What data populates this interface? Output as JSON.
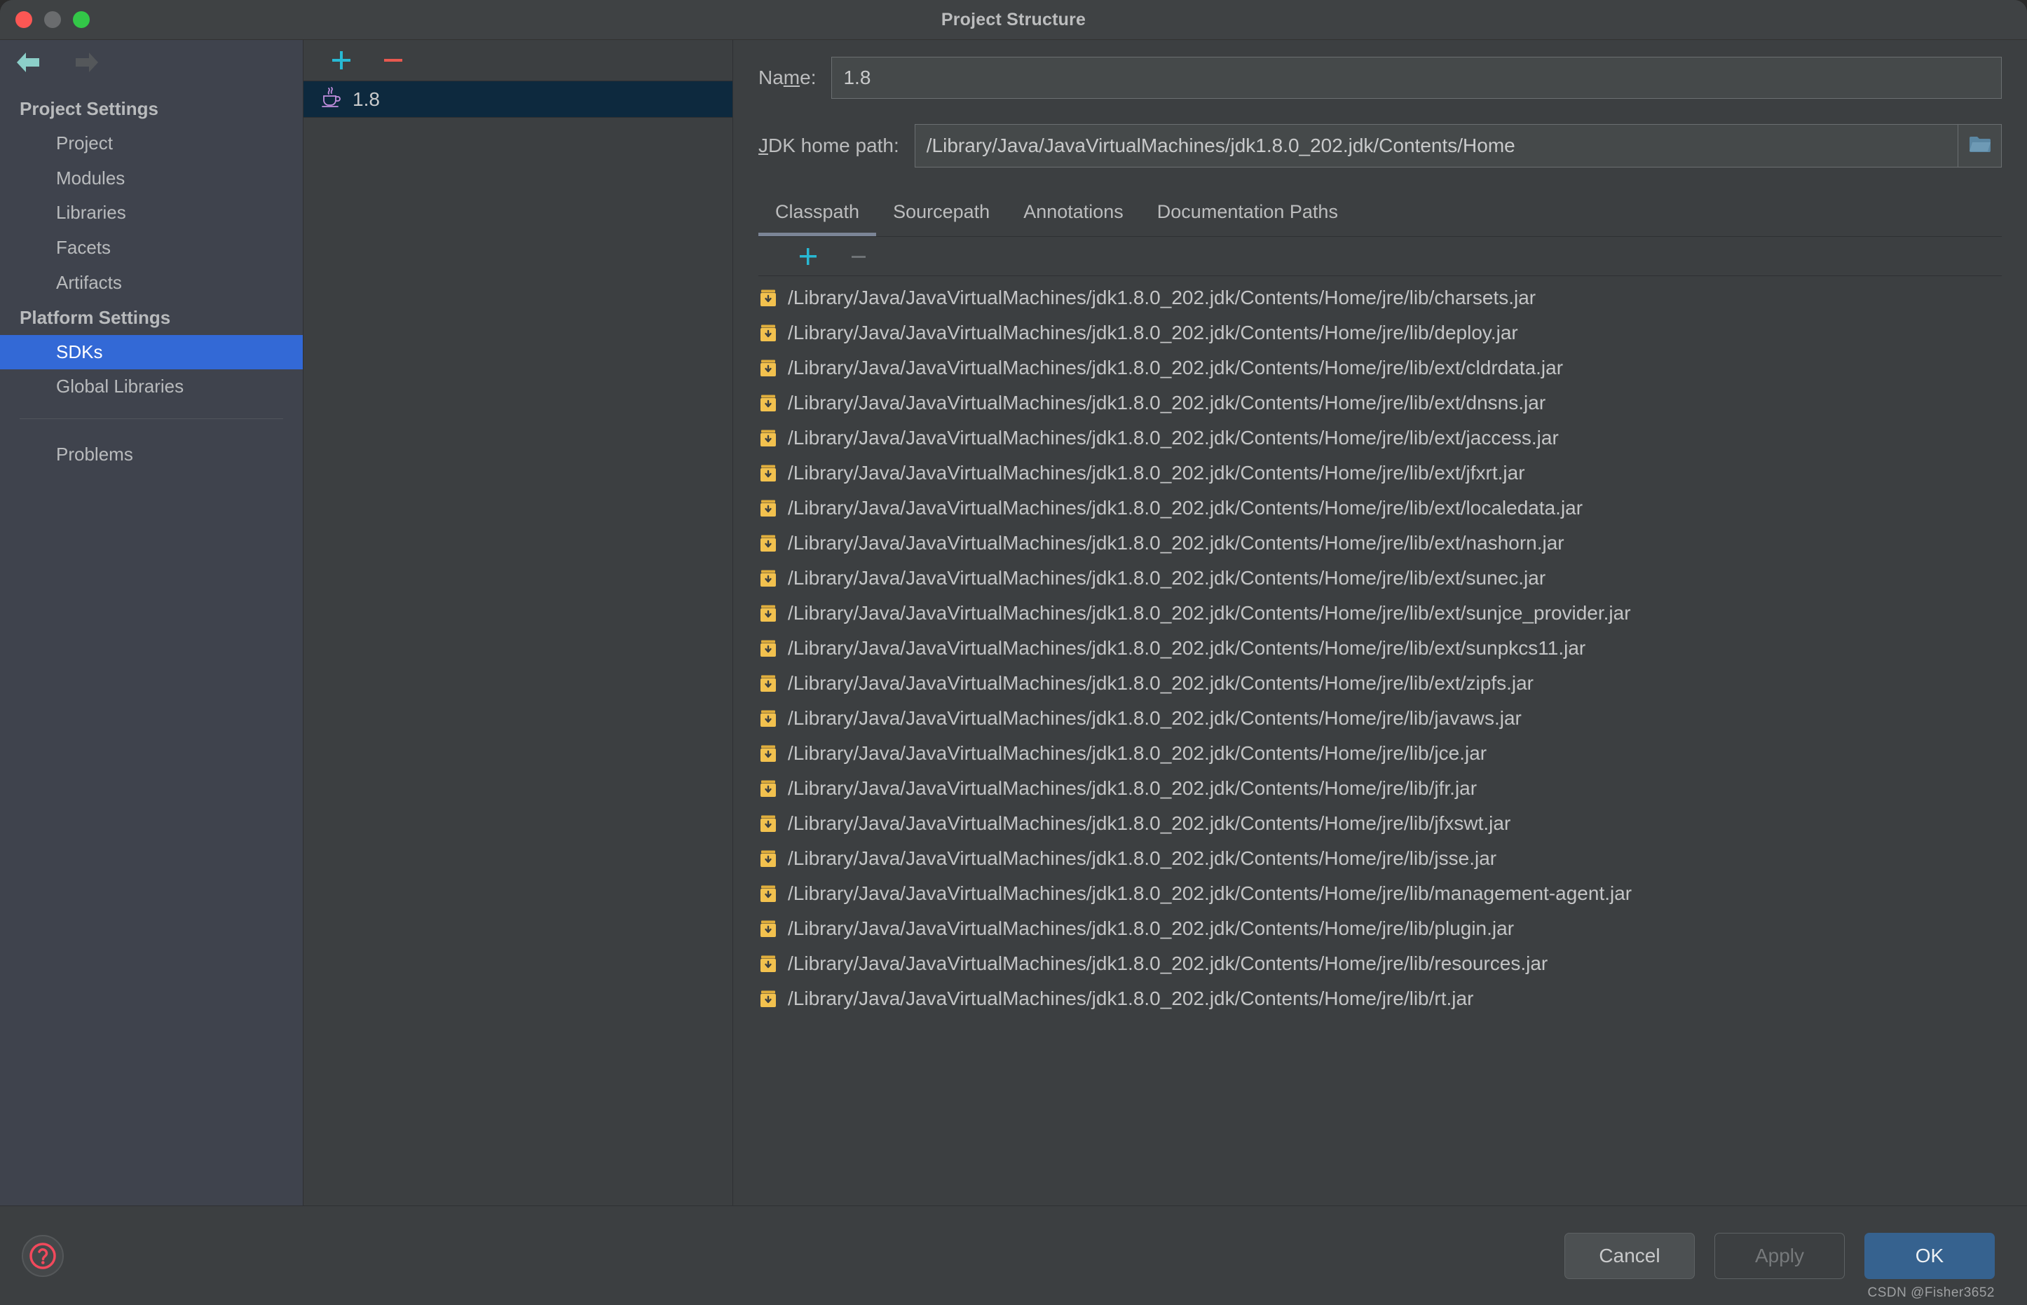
{
  "window": {
    "title": "Project Structure",
    "traffic_lights": [
      "close-red",
      "minimize-yellow",
      "zoom-green"
    ]
  },
  "sidebar": {
    "nav": {
      "back": "back-arrow",
      "forward": "forward-arrow"
    },
    "groups": [
      {
        "title": "Project Settings",
        "items": [
          {
            "label": "Project",
            "selected": false
          },
          {
            "label": "Modules",
            "selected": false
          },
          {
            "label": "Libraries",
            "selected": false
          },
          {
            "label": "Facets",
            "selected": false
          },
          {
            "label": "Artifacts",
            "selected": false
          }
        ]
      },
      {
        "title": "Platform Settings",
        "items": [
          {
            "label": "SDKs",
            "selected": true
          },
          {
            "label": "Global Libraries",
            "selected": false
          }
        ]
      }
    ],
    "extra": [
      {
        "label": "Problems",
        "selected": false
      }
    ],
    "selected_accent": "#3369d6"
  },
  "sdk_panel": {
    "toolbar": {
      "add_label": "+",
      "remove_label": "–"
    },
    "items": [
      {
        "name": "1.8",
        "icon": "java-coffee-cup-icon",
        "selected": true
      }
    ],
    "selected_bg": "#0d293e"
  },
  "detail": {
    "name_label": "Name:",
    "name_mnemonic": "m",
    "name_value": "1.8",
    "path_label": "JDK home path:",
    "path_value": "/Library/Java/JavaVirtualMachines/jdk1.8.0_202.jdk/Contents/Home",
    "browse_icon": "folder-icon",
    "tabs": [
      {
        "label": "Classpath",
        "active": true
      },
      {
        "label": "Sourcepath",
        "active": false
      },
      {
        "label": "Annotations",
        "active": false
      },
      {
        "label": "Documentation Paths",
        "active": false
      }
    ],
    "classpath_toolbar": {
      "add_label": "+",
      "remove_label": "–"
    },
    "classpath": [
      "/Library/Java/JavaVirtualMachines/jdk1.8.0_202.jdk/Contents/Home/jre/lib/charsets.jar",
      "/Library/Java/JavaVirtualMachines/jdk1.8.0_202.jdk/Contents/Home/jre/lib/deploy.jar",
      "/Library/Java/JavaVirtualMachines/jdk1.8.0_202.jdk/Contents/Home/jre/lib/ext/cldrdata.jar",
      "/Library/Java/JavaVirtualMachines/jdk1.8.0_202.jdk/Contents/Home/jre/lib/ext/dnsns.jar",
      "/Library/Java/JavaVirtualMachines/jdk1.8.0_202.jdk/Contents/Home/jre/lib/ext/jaccess.jar",
      "/Library/Java/JavaVirtualMachines/jdk1.8.0_202.jdk/Contents/Home/jre/lib/ext/jfxrt.jar",
      "/Library/Java/JavaVirtualMachines/jdk1.8.0_202.jdk/Contents/Home/jre/lib/ext/localedata.jar",
      "/Library/Java/JavaVirtualMachines/jdk1.8.0_202.jdk/Contents/Home/jre/lib/ext/nashorn.jar",
      "/Library/Java/JavaVirtualMachines/jdk1.8.0_202.jdk/Contents/Home/jre/lib/ext/sunec.jar",
      "/Library/Java/JavaVirtualMachines/jdk1.8.0_202.jdk/Contents/Home/jre/lib/ext/sunjce_provider.jar",
      "/Library/Java/JavaVirtualMachines/jdk1.8.0_202.jdk/Contents/Home/jre/lib/ext/sunpkcs11.jar",
      "/Library/Java/JavaVirtualMachines/jdk1.8.0_202.jdk/Contents/Home/jre/lib/ext/zipfs.jar",
      "/Library/Java/JavaVirtualMachines/jdk1.8.0_202.jdk/Contents/Home/jre/lib/javaws.jar",
      "/Library/Java/JavaVirtualMachines/jdk1.8.0_202.jdk/Contents/Home/jre/lib/jce.jar",
      "/Library/Java/JavaVirtualMachines/jdk1.8.0_202.jdk/Contents/Home/jre/lib/jfr.jar",
      "/Library/Java/JavaVirtualMachines/jdk1.8.0_202.jdk/Contents/Home/jre/lib/jfxswt.jar",
      "/Library/Java/JavaVirtualMachines/jdk1.8.0_202.jdk/Contents/Home/jre/lib/jsse.jar",
      "/Library/Java/JavaVirtualMachines/jdk1.8.0_202.jdk/Contents/Home/jre/lib/management-agent.jar",
      "/Library/Java/JavaVirtualMachines/jdk1.8.0_202.jdk/Contents/Home/jre/lib/plugin.jar",
      "/Library/Java/JavaVirtualMachines/jdk1.8.0_202.jdk/Contents/Home/jre/lib/resources.jar",
      "/Library/Java/JavaVirtualMachines/jdk1.8.0_202.jdk/Contents/Home/jre/lib/rt.jar"
    ]
  },
  "footer": {
    "help_icon": "help-question-icon",
    "buttons": [
      {
        "label": "Cancel",
        "kind": "cancel",
        "enabled": true
      },
      {
        "label": "Apply",
        "kind": "apply",
        "enabled": false
      },
      {
        "label": "OK",
        "kind": "ok",
        "enabled": true
      }
    ],
    "watermark": "CSDN @Fisher3652"
  },
  "colors": {
    "window_bg": "#3c3f41",
    "sidebar_bg": "#3f434d",
    "accent_blue": "#3369d6",
    "ok_button": "#36628f",
    "add_icon": "#28b9d4",
    "remove_icon": "#e8594f",
    "jar_icon": "#f2c14e",
    "java_icon": "#c38fdf"
  }
}
